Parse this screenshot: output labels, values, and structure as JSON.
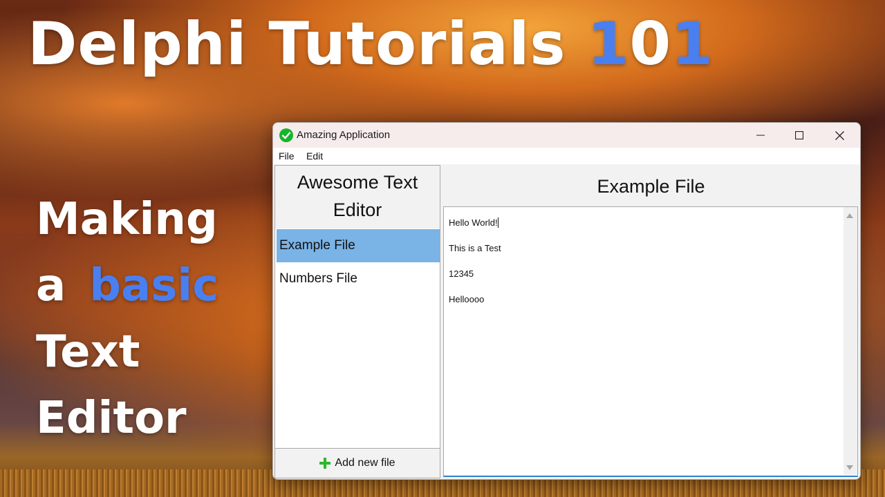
{
  "thumbnail": {
    "headline_main": "Delphi Tutorials ",
    "headline_num_a": "1",
    "headline_num_b": "0",
    "headline_num_c": "1",
    "subtitle_line1": "Making",
    "subtitle_line2_a": "a",
    "subtitle_line2_b": "basic",
    "subtitle_line3": "Text",
    "subtitle_line4": "Editor",
    "accent_color": "#4a7ff0"
  },
  "window": {
    "title": "Amazing Application",
    "icon": "green-check-icon",
    "controls": {
      "minimize": "minimize-icon",
      "maximize": "maximize-icon",
      "close": "close-icon"
    }
  },
  "menubar": {
    "items": [
      "File",
      "Edit"
    ]
  },
  "sidebar": {
    "header": "Awesome Text Editor",
    "files": [
      {
        "label": "Example File",
        "selected": true
      },
      {
        "label": "Numbers File",
        "selected": false
      }
    ],
    "add_button_label": "Add new file",
    "add_button_icon": "plus-icon",
    "selected_color": "#7ab3e6"
  },
  "editor": {
    "title": "Example File",
    "lines": [
      "Hello World!",
      "This is a Test",
      "12345",
      "Helloooo"
    ]
  }
}
